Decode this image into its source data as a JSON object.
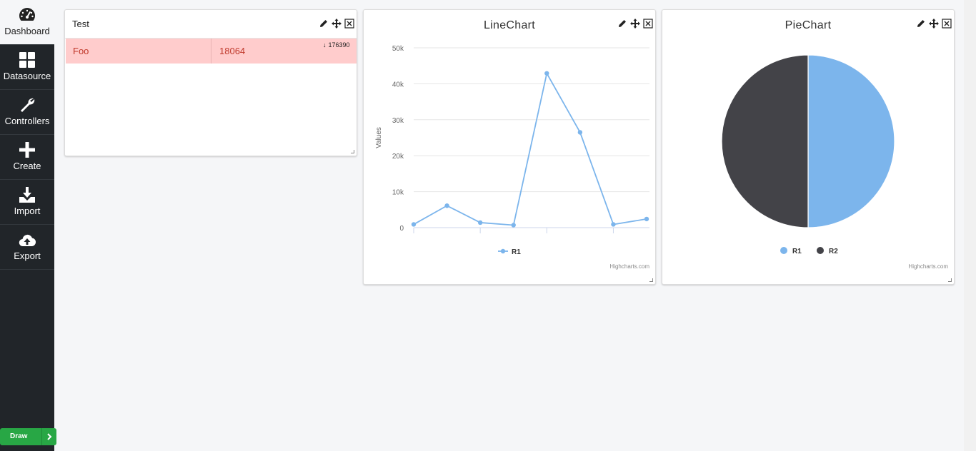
{
  "sidebar": {
    "items": [
      {
        "label": "Dashboard",
        "icon": "gauge-icon",
        "active": true
      },
      {
        "label": "Datasource",
        "icon": "grid-icon",
        "active": false
      },
      {
        "label": "Controllers",
        "icon": "wrench-icon",
        "active": false
      },
      {
        "label": "Create",
        "icon": "plus-icon",
        "active": false
      },
      {
        "label": "Import",
        "icon": "download-icon",
        "active": false
      },
      {
        "label": "Export",
        "icon": "cloud-upload-icon",
        "active": false
      }
    ],
    "draw_label": "Draw",
    "draw_icon": "chevron-right-icon"
  },
  "widgets": {
    "test": {
      "title": "Test",
      "row": {
        "name": "Foo",
        "value": "18064",
        "trend_value": "176390",
        "trend_icon": "arrow-down-icon"
      }
    },
    "line": {
      "title": "LineChart",
      "credits": "Highcharts.com"
    },
    "pie": {
      "title": "PieChart",
      "credits": "Highcharts.com"
    },
    "tool_icons": [
      "pencil-icon",
      "move-icon",
      "close-icon"
    ]
  },
  "colors": {
    "sidebar_bg": "#212529",
    "series_r1": "#7cb5ec",
    "series_r2": "#434348",
    "row_alert_bg": "#ffcccc",
    "row_alert_text": "#c0392b",
    "draw_button": "#28a745"
  },
  "chart_data": [
    {
      "type": "line",
      "title": "LineChart",
      "ylabel": "Values",
      "ylim": [
        0,
        50000
      ],
      "yticks": [
        "0",
        "10k",
        "20k",
        "30k",
        "40k",
        "50k"
      ],
      "grid": true,
      "legend": "bottom-center",
      "series": [
        {
          "name": "R1",
          "values": [
            900,
            6100,
            1400,
            700,
            42900,
            26500,
            900,
            2400
          ]
        }
      ]
    },
    {
      "type": "pie",
      "title": "PieChart",
      "legend": "bottom-center",
      "slices": [
        {
          "name": "R1",
          "value": 50
        },
        {
          "name": "R2",
          "value": 50
        }
      ]
    }
  ]
}
